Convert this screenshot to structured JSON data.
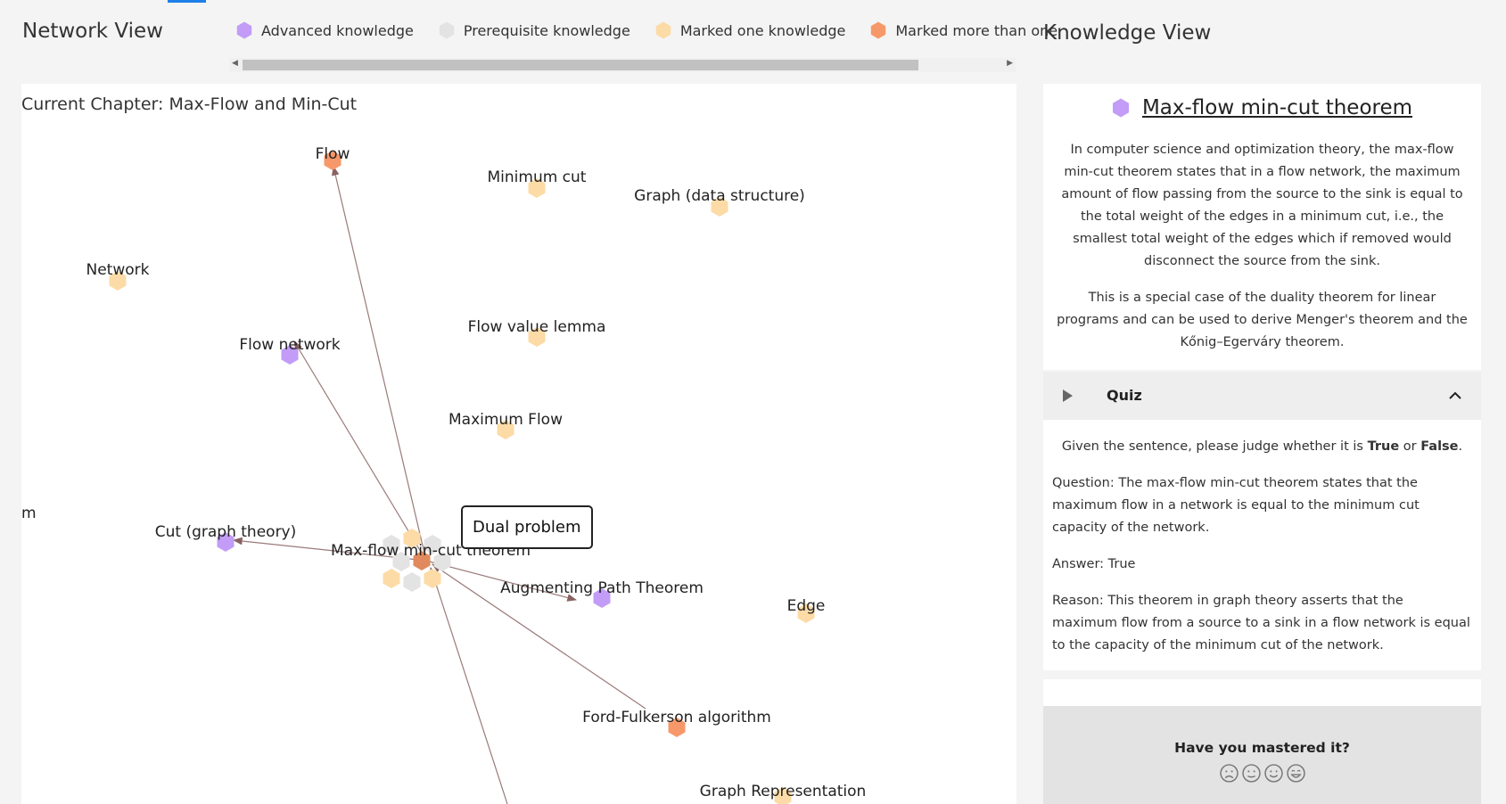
{
  "network_view": {
    "title": "Network View",
    "legend": [
      {
        "label": "Advanced knowledge",
        "color": "#c29cf7"
      },
      {
        "label": "Prerequisite knowledge",
        "color": "#e3e3e3"
      },
      {
        "label": "Marked one knowledge",
        "color": "#fcdba6"
      },
      {
        "label": "Marked more than one",
        "color": "#f7986a"
      }
    ],
    "chapter_label": "Current Chapter: Max-Flow and Min-Cut",
    "tooltip": "Dual problem",
    "clipped_label": "m",
    "nodes": [
      {
        "label": "Flow"
      },
      {
        "label": "Minimum cut"
      },
      {
        "label": "Graph (data structure)"
      },
      {
        "label": "Network"
      },
      {
        "label": "Flow value lemma"
      },
      {
        "label": "Flow network"
      },
      {
        "label": "Maximum Flow"
      },
      {
        "label": "Cut (graph theory)"
      },
      {
        "label": "Max-flow min-cut theorem"
      },
      {
        "label": "Augmenting Path Theorem"
      },
      {
        "label": "Edge"
      },
      {
        "label": "Ford-Fulkerson algorithm"
      },
      {
        "label": "Graph Representation"
      }
    ]
  },
  "knowledge_view": {
    "title": "Knowledge View",
    "concept_title": "Max-flow min-cut theorem",
    "concept_color": "#c29cf7",
    "paragraphs": [
      "In computer science and optimization theory, the max-flow min-cut theorem states that in a flow network, the maximum amount of flow passing from the source to the sink is equal to the total weight of the edges in a minimum cut, i.e., the smallest total weight of the edges which if removed would disconnect the source from the sink.",
      "This is a special case of the duality theorem for linear programs and can be used to derive Menger's theorem and the Kőnig–Egerváry theorem."
    ],
    "quiz": {
      "label": "Quiz",
      "instruction_prefix": "Given the sentence, please judge whether it is ",
      "instruction_true": "True",
      "instruction_or": " or ",
      "instruction_false": "False",
      "instruction_end": ".",
      "question": "Question: The max-flow min-cut theorem states that the maximum flow in a network is equal to the minimum cut capacity of the network.",
      "answer": "Answer: True",
      "reason": "Reason: This theorem in graph theory asserts that the maximum flow from a source to a sink in a flow network is equal to the capacity of the minimum cut of the network."
    },
    "mastery": {
      "question": "Have you mastered it?",
      "options": [
        "sad-face",
        "neutral-face",
        "smile-face",
        "happy-face"
      ]
    }
  }
}
